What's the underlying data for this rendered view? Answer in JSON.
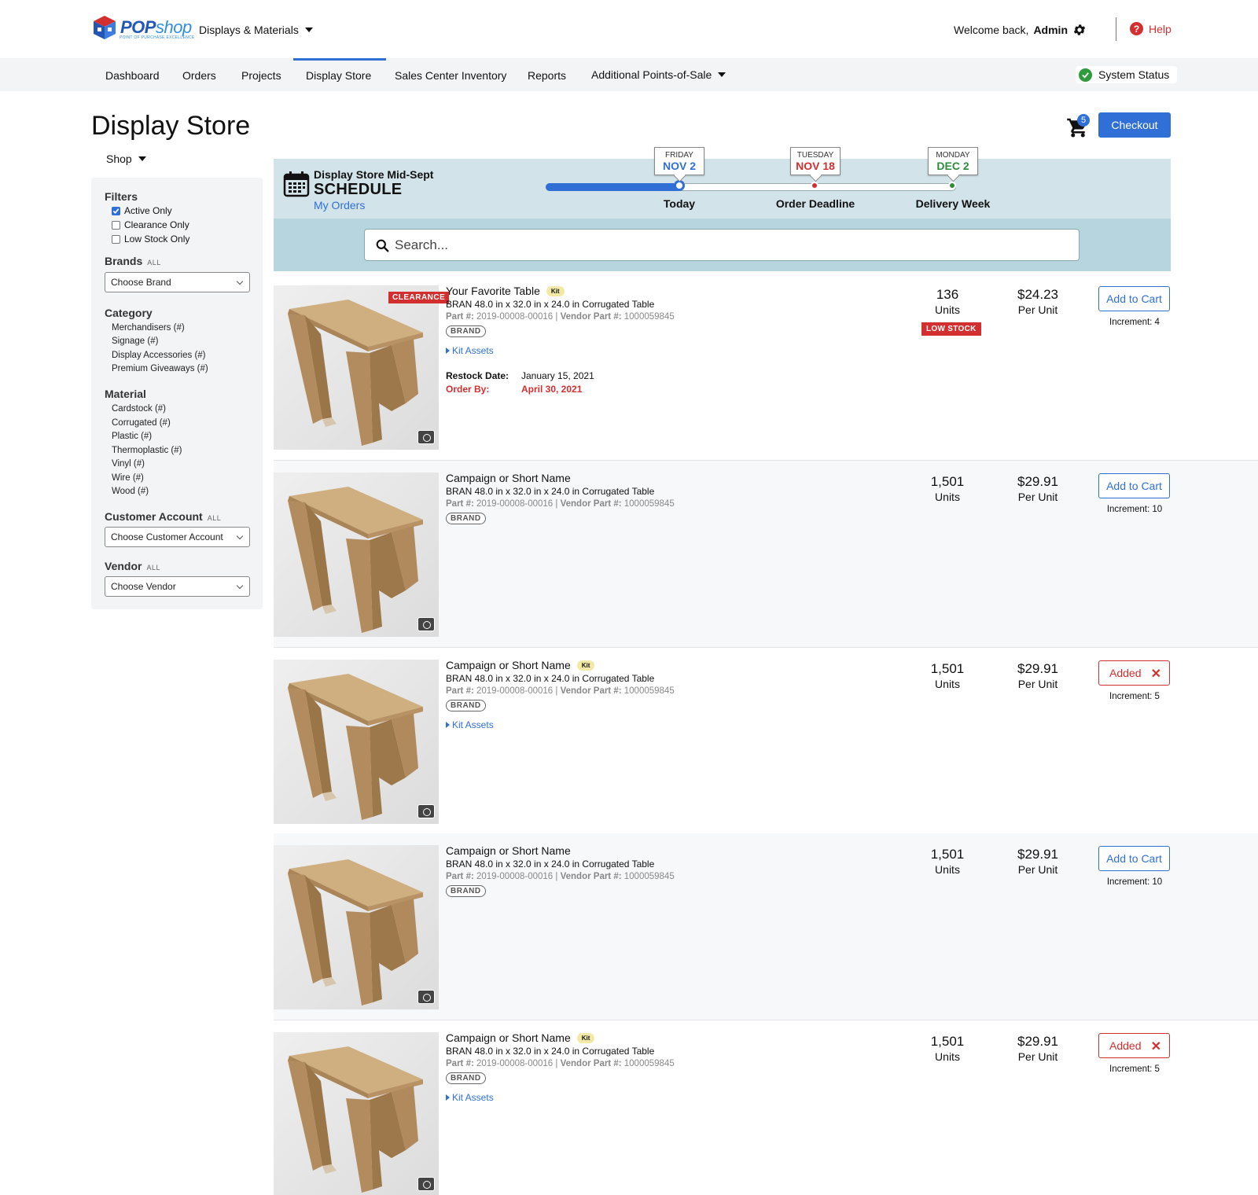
{
  "header": {
    "logo_pop": "POP",
    "logo_shop": "shop",
    "logo_tagline": "POINT OF PURCHASE EXCELLENCE",
    "app_switch": "Displays & Materials",
    "welcome_prefix": "Welcome back,",
    "welcome_user": "Admin",
    "help": "Help"
  },
  "nav": {
    "items": [
      "Dashboard",
      "Orders",
      "Projects",
      "Display Store",
      "Sales Center Inventory",
      "Reports",
      "Additional Points-of-Sale"
    ],
    "active": "Display Store",
    "system_status": "System Status"
  },
  "page": {
    "title": "Display Store",
    "shop_menu": "Shop",
    "cart_count": "5",
    "checkout": "Checkout"
  },
  "sidebar": {
    "filters_title": "Filters",
    "filters": [
      {
        "label": "Active Only",
        "checked": true
      },
      {
        "label": "Clearance Only",
        "checked": false
      },
      {
        "label": "Low Stock Only",
        "checked": false
      }
    ],
    "brands_title": "Brands",
    "brands_all": "ALL",
    "brands_select": "Choose Brand",
    "category_title": "Category",
    "categories": [
      "Merchandisers (#)",
      "Signage (#)",
      "Display Accessories (#)",
      "Premium Giveaways (#)"
    ],
    "material_title": "Material",
    "materials": [
      "Cardstock (#)",
      "Corrugated (#)",
      "Plastic (#)",
      "Thermoplastic (#)",
      "Vinyl (#)",
      "Wire (#)",
      "Wood (#)"
    ],
    "customer_title": "Customer Account",
    "customer_all": "ALL",
    "customer_select": "Choose Customer Account",
    "vendor_title": "Vendor",
    "vendor_all": "ALL",
    "vendor_select": "Choose Vendor"
  },
  "schedule": {
    "subtitle": "Display Store Mid-Sept",
    "title": "SCHEDULE",
    "link": "My Orders",
    "progress_fraction": 0.33,
    "milestones": [
      {
        "day": "FRIDAY",
        "date": "NOV 2",
        "label": "Today",
        "color": "#2f6fd6"
      },
      {
        "day": "TUESDAY",
        "date": "NOV 18",
        "label": "Order Deadline",
        "color": "#d32f2f"
      },
      {
        "day": "MONDAY",
        "date": "DEC 2",
        "label": "Delivery Week",
        "color": "#2e8b3c"
      }
    ]
  },
  "search": {
    "placeholder": "Search..."
  },
  "labels": {
    "units": "Units",
    "per_unit": "Per Unit",
    "kit": "Kit",
    "brand": "BRAND",
    "kit_assets": "Kit Assets",
    "part_label": "Part #:",
    "vendor_part_label": "Vendor Part #:",
    "restock_label": "Restock Date:",
    "order_by_label": "Order By:",
    "clearance": "CLEARANCE",
    "low_stock": "LOW STOCK",
    "add_to_cart": "Add to Cart",
    "added": "Added"
  },
  "products": [
    {
      "name": "Your Favorite Table",
      "kit": true,
      "desc": "BRAN 48.0 in x 32.0 in x 24.0 in Corrugated Table",
      "part": "2019-00008-00016",
      "vendor_part": "1000059845",
      "units": "136",
      "price": "$24.23",
      "increment": "Increment: 4",
      "added": false,
      "clearance": true,
      "low_stock": true,
      "restock_date": "January 15, 2021",
      "order_by": "April 30, 2021"
    },
    {
      "name": "Campaign or Short Name",
      "kit": false,
      "desc": "BRAN 48.0 in x 32.0 in x 24.0 in Corrugated Table",
      "part": "2019-00008-00016",
      "vendor_part": "1000059845",
      "units": "1,501",
      "price": "$29.91",
      "increment": "Increment: 10",
      "added": false
    },
    {
      "name": "Campaign or Short Name",
      "kit": true,
      "desc": "BRAN 48.0 in x 32.0 in x 24.0 in Corrugated Table",
      "part": "2019-00008-00016",
      "vendor_part": "1000059845",
      "units": "1,501",
      "price": "$29.91",
      "increment": "Increment: 5",
      "added": true
    },
    {
      "name": "Campaign or Short Name",
      "kit": false,
      "desc": "BRAN 48.0 in x 32.0 in x 24.0 in Corrugated Table",
      "part": "2019-00008-00016",
      "vendor_part": "1000059845",
      "units": "1,501",
      "price": "$29.91",
      "increment": "Increment: 10",
      "added": false
    },
    {
      "name": "Campaign or Short Name",
      "kit": true,
      "desc": "BRAN 48.0 in x 32.0 in x 24.0 in Corrugated Table",
      "part": "2019-00008-00016",
      "vendor_part": "1000059845",
      "units": "1,501",
      "price": "$29.91",
      "increment": "Increment: 5",
      "added": true
    }
  ],
  "colors": {
    "accent": "#2f6fd6",
    "danger": "#d32f2f",
    "success": "#2e9b3c"
  }
}
